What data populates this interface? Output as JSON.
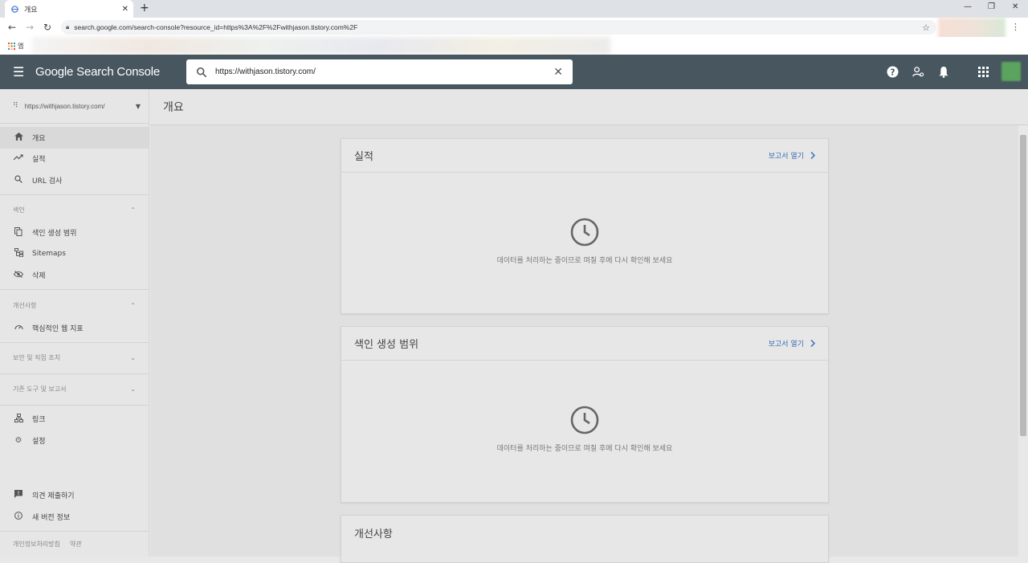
{
  "browser": {
    "tab_title": "개요",
    "url": "search.google.com/search-console?resource_id=https%3A%2F%2Fwithjason.tistory.com%2F",
    "bookmarks_apps_label": "앱"
  },
  "header": {
    "brand": "Google Search Console",
    "search_value": "https://withjason.tistory.com/"
  },
  "sidebar": {
    "property": "https://withjason.tistory.com/",
    "items_top": [
      {
        "label": "개요",
        "icon": "home-icon"
      },
      {
        "label": "실적",
        "icon": "trending-up-icon"
      },
      {
        "label": "URL 검사",
        "icon": "search-icon"
      }
    ],
    "section_index": "색인",
    "items_index": [
      {
        "label": "색인 생성 범위",
        "icon": "file-copy-icon"
      },
      {
        "label": "Sitemaps",
        "icon": "sitemap-icon"
      },
      {
        "label": "삭제",
        "icon": "visibility-off-icon"
      }
    ],
    "section_enhancements": "개선사항",
    "items_enhancements": [
      {
        "label": "핵심적인 웹 지표",
        "icon": "speed-icon"
      }
    ],
    "section_security": "보안 및 직접 조치",
    "section_legacy": "기존 도구 및 보고서",
    "items_bottom": [
      {
        "label": "링크",
        "icon": "links-icon"
      },
      {
        "label": "설정",
        "icon": "settings-icon"
      }
    ],
    "items_footer": [
      {
        "label": "의견 제출하기",
        "icon": "feedback-icon"
      },
      {
        "label": "새 버전 정보",
        "icon": "info-icon"
      }
    ],
    "footer_links": [
      "개인정보처리방침",
      "약관"
    ]
  },
  "page": {
    "title": "개요",
    "open_report": "보고서 열기",
    "processing_message": "데이터를 처리하는 중이므로 며칠 후에 다시 확인해 보세요",
    "cards": [
      "실적",
      "색인 생성 범위",
      "개선사항"
    ]
  },
  "colors": {
    "appbar": "#47565f",
    "link": "#3b6db5"
  }
}
